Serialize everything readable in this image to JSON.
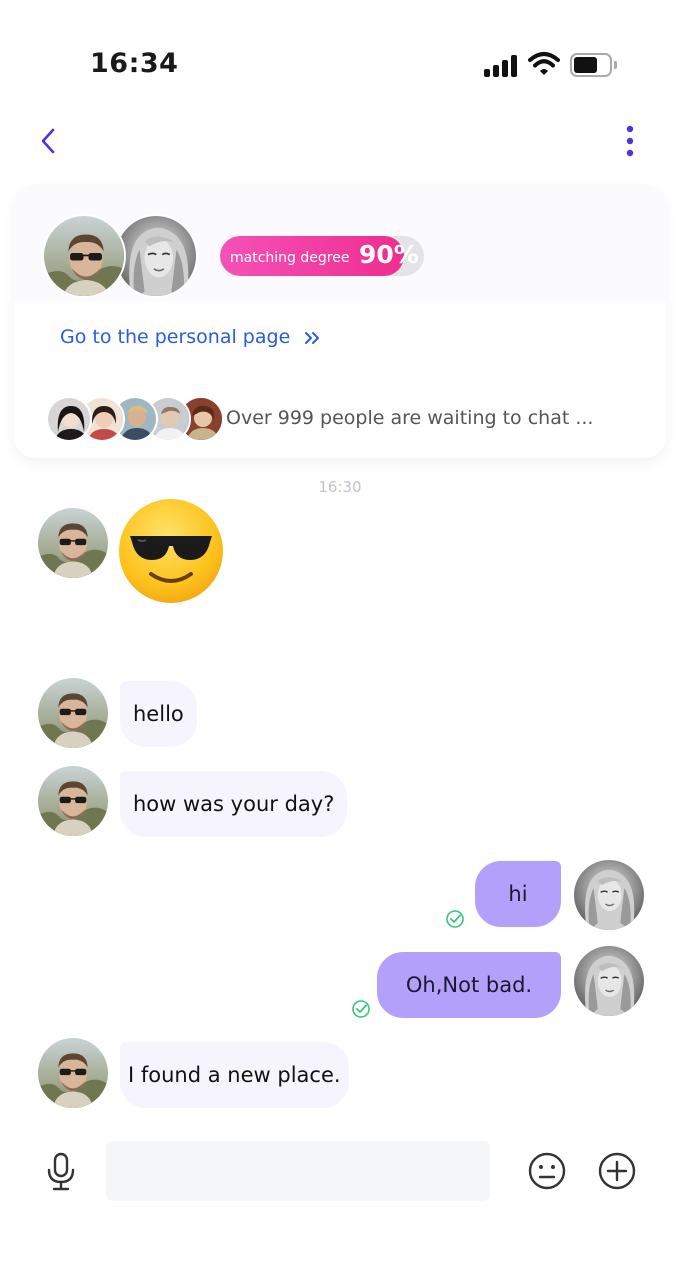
{
  "status_bar": {
    "time": "16:34",
    "battery_level": 0.6
  },
  "nav": {
    "back_icon": "chevron-left-icon",
    "menu_icon": "more-vertical-icon",
    "accent": "#4a35d8"
  },
  "match_card": {
    "matching_label": "matching degree",
    "matching_value": "90%",
    "matching_fraction": 0.9,
    "personal_page_link": "Go to the personal page",
    "link_icon": "double-chevron-right-icon",
    "waiting_text": "Over 999 people are waiting to chat ...",
    "bar_color": "#ef2d8f"
  },
  "chat": {
    "timestamp": "16:30",
    "messages": [
      {
        "from": "them",
        "type": "emoji",
        "emoji": "smiling-face-with-sunglasses-icon"
      },
      {
        "from": "them",
        "type": "text",
        "text": "hello"
      },
      {
        "from": "them",
        "type": "text",
        "text": "how was your day?"
      },
      {
        "from": "me",
        "type": "text",
        "text": "hi",
        "status": "read"
      },
      {
        "from": "me",
        "type": "text",
        "text": "Oh,Not bad.",
        "status": "read"
      },
      {
        "from": "them",
        "type": "text",
        "text": "I found a new place."
      }
    ],
    "incoming_bubble_color": "#f6f5fe",
    "outgoing_bubble_color": "#b2a0fb",
    "read_check_color": "#3cc47c"
  },
  "input_bar": {
    "placeholder": "",
    "mic_icon": "microphone-icon",
    "emoji_icon": "neutral-face-icon",
    "add_icon": "plus-circle-icon"
  }
}
